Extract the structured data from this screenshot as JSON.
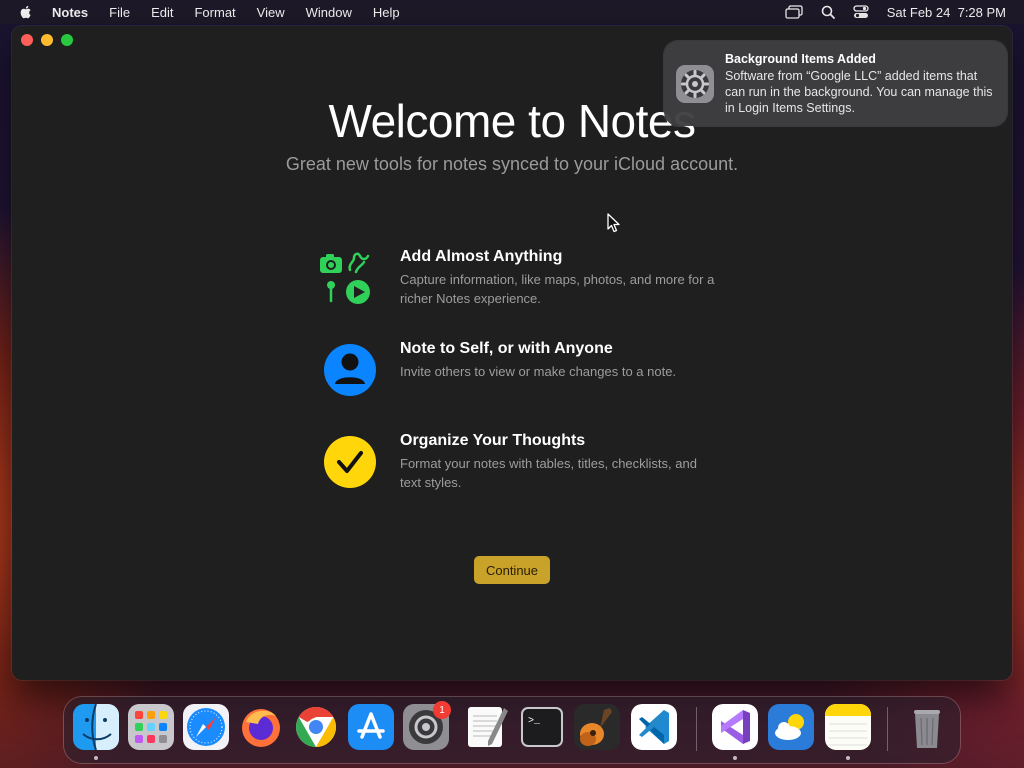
{
  "menubar": {
    "app_name": "Notes",
    "items": [
      "File",
      "Edit",
      "Format",
      "View",
      "Window",
      "Help"
    ],
    "clock": "Sat Feb 24  7:28 PM"
  },
  "welcome": {
    "title": "Welcome to Notes",
    "subtitle": "Great new tools for notes synced to your iCloud account.",
    "features": [
      {
        "heading": "Add Almost Anything",
        "description": "Capture information, like maps, photos, and more for a richer Notes experience.",
        "icon": "media-attachments-icon"
      },
      {
        "heading": "Note to Self, or with Anyone",
        "description": "Invite others to view or make changes to a note.",
        "icon": "person-icon"
      },
      {
        "heading": "Organize Your Thoughts",
        "description": "Format your notes with tables, titles, checklists, and text styles.",
        "icon": "checkmark-icon"
      }
    ],
    "continue_label": "Continue"
  },
  "notification": {
    "title": "Background Items Added",
    "body": "Software from “Google LLC” added items that can run in the background. You can manage this in Login Items Settings.",
    "icon": "system-settings-gear-icon"
  },
  "dock": {
    "apps": [
      "Finder",
      "Launchpad",
      "Safari",
      "Firefox",
      "Google Chrome",
      "App Store",
      "System Settings",
      "TextEdit",
      "Terminal",
      "GarageBand",
      "Visual Studio Code",
      "Visual Studio",
      "Weather",
      "Notes",
      "Trash"
    ],
    "system_settings_badge": "1"
  },
  "colors": {
    "accent_continue": "#c9a22a",
    "feature_green": "#30d158",
    "person_blue": "#0a84ff",
    "check_yellow": "#ffd60a"
  }
}
